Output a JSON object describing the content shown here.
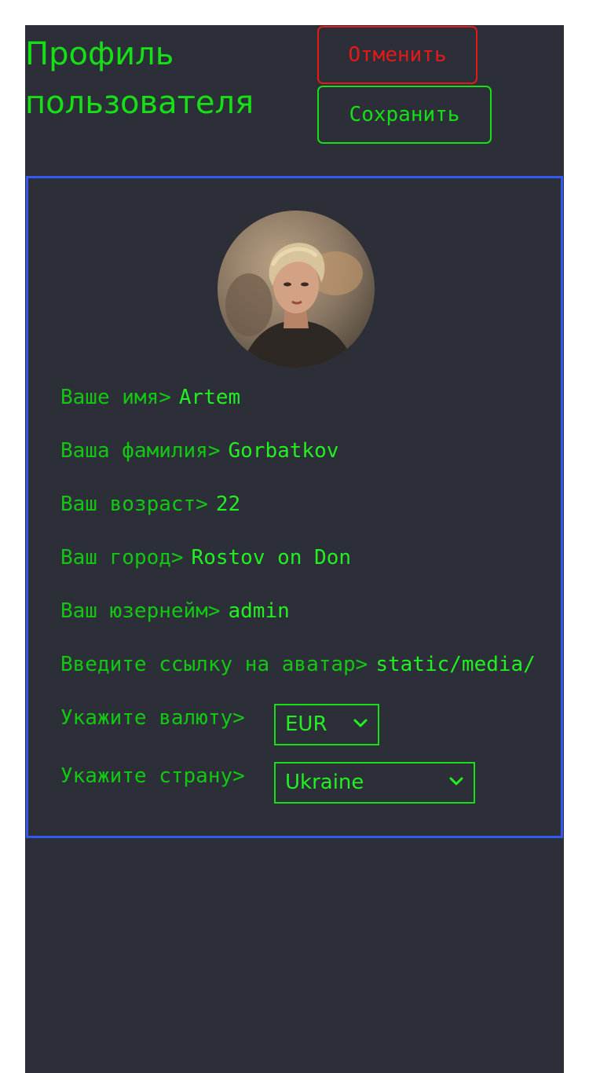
{
  "header": {
    "title": "Профиль пользователя",
    "cancel_label": "Отменить",
    "save_label": "Сохранить"
  },
  "profile": {
    "avatar_icon": "user-avatar-portrait",
    "fields": [
      {
        "label": "Ваше имя>",
        "value": "Artem"
      },
      {
        "label": "Ваша фамилия>",
        "value": "Gorbatkov"
      },
      {
        "label": "Ваш возраст>",
        "value": "22"
      },
      {
        "label": "Ваш город>",
        "value": "Rostov on Don"
      },
      {
        "label": "Ваш юзернейм>",
        "value": "admin"
      },
      {
        "label": "Введите ссылку на аватар>",
        "value": "static/media/"
      }
    ],
    "currency": {
      "label": "Укажите валюту>",
      "selected": "EUR"
    },
    "country": {
      "label": "Укажите страну>",
      "selected": "Ukraine"
    }
  },
  "colors": {
    "background": "#2c2f37",
    "accent_green": "#15e015",
    "cancel_red": "#e41a1a",
    "card_border_blue": "#3358f0"
  }
}
